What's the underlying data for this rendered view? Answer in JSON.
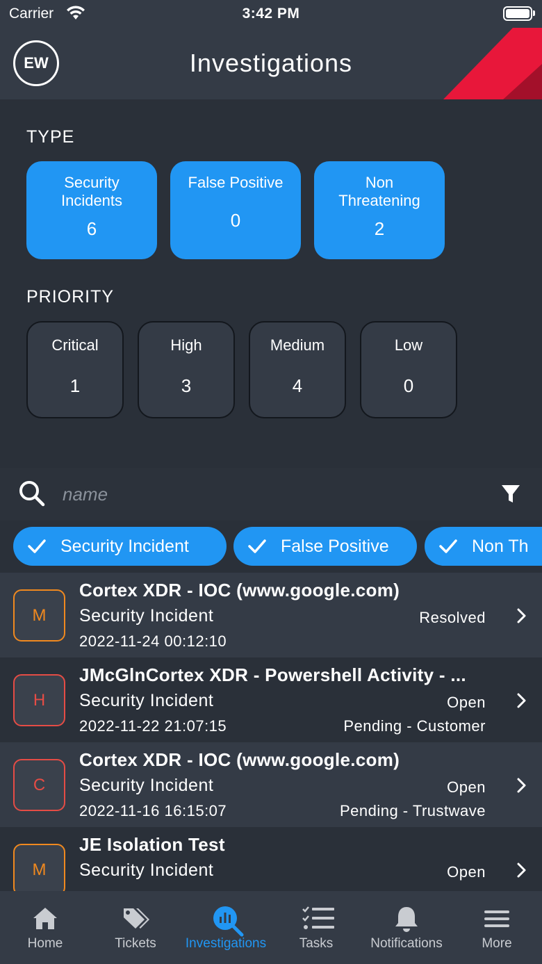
{
  "status_bar": {
    "carrier": "Carrier",
    "time": "3:42 PM"
  },
  "header": {
    "avatar_initials": "EW",
    "title": "Investigations"
  },
  "type_section": {
    "label": "TYPE",
    "cards": [
      {
        "label": "Security Incidents",
        "count": "6"
      },
      {
        "label": "False Positive",
        "count": "0"
      },
      {
        "label": "Non Threatening",
        "count": "2"
      }
    ]
  },
  "priority_section": {
    "label": "PRIORITY",
    "cards": [
      {
        "label": "Critical",
        "count": "1"
      },
      {
        "label": "High",
        "count": "3"
      },
      {
        "label": "Medium",
        "count": "4"
      },
      {
        "label": "Low",
        "count": "0"
      }
    ]
  },
  "search": {
    "placeholder": "name",
    "value": ""
  },
  "filter_chips": [
    {
      "label": "Security Incident"
    },
    {
      "label": "False Positive"
    },
    {
      "label": "Non Th"
    }
  ],
  "investigations": [
    {
      "priority": "M",
      "title": "Cortex XDR - IOC (www.google.com)",
      "type": "Security Incident",
      "date": "2022-11-24 00:12:10",
      "status": "Resolved",
      "substatus": ""
    },
    {
      "priority": "H",
      "title": "JMcGlnCortex XDR - Powershell Activity - ...",
      "type": "Security Incident",
      "date": "2022-11-22 21:07:15",
      "status": "Open",
      "substatus": "Pending - Customer"
    },
    {
      "priority": "C",
      "title": "Cortex XDR - IOC (www.google.com)",
      "type": "Security Incident",
      "date": "2022-11-16 16:15:07",
      "status": "Open",
      "substatus": "Pending - Trustwave"
    },
    {
      "priority": "M",
      "title": "JE Isolation Test",
      "type": "Security Incident",
      "date": "",
      "status": "Open",
      "substatus": ""
    }
  ],
  "tab_bar": {
    "tabs": [
      {
        "label": "Home",
        "icon": "home-icon"
      },
      {
        "label": "Tickets",
        "icon": "tags-icon"
      },
      {
        "label": "Investigations",
        "icon": "investigations-icon"
      },
      {
        "label": "Tasks",
        "icon": "tasks-icon"
      },
      {
        "label": "Notifications",
        "icon": "bell-icon"
      },
      {
        "label": "More",
        "icon": "menu-icon"
      }
    ],
    "active": "Investigations"
  },
  "colors": {
    "background": "#2a3039",
    "panel": "#343b46",
    "accent_blue": "#2196f3",
    "priority_medium": "#f0891f",
    "priority_high": "#e54c45",
    "brand_red": "#e8173a"
  }
}
